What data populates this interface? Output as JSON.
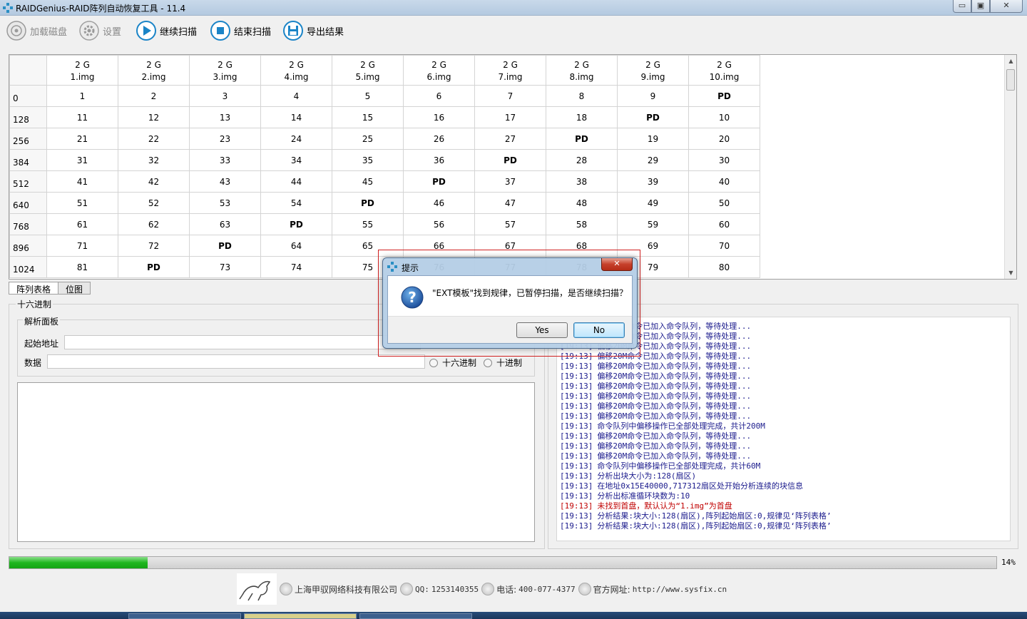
{
  "window": {
    "title": "RAIDGenius-RAID阵列自动恢复工具 - 11.4",
    "min": "▭",
    "max": "▣",
    "close": "✕"
  },
  "toolbar": {
    "load_disk": "加载磁盘",
    "settings": "设置",
    "continue_scan": "继续扫描",
    "stop_scan": "结束扫描",
    "export": "导出结果"
  },
  "grid": {
    "columns": [
      {
        "size": "2 G",
        "file": "1.img"
      },
      {
        "size": "2 G",
        "file": "2.img"
      },
      {
        "size": "2 G",
        "file": "3.img"
      },
      {
        "size": "2 G",
        "file": "4.img"
      },
      {
        "size": "2 G",
        "file": "5.img"
      },
      {
        "size": "2 G",
        "file": "6.img"
      },
      {
        "size": "2 G",
        "file": "7.img"
      },
      {
        "size": "2 G",
        "file": "8.img"
      },
      {
        "size": "2 G",
        "file": "9.img"
      },
      {
        "size": "2 G",
        "file": "10.img"
      }
    ],
    "rows": [
      {
        "offset": "0",
        "cells": [
          "1",
          "2",
          "3",
          "4",
          "5",
          "6",
          "7",
          "8",
          "9",
          "PD"
        ]
      },
      {
        "offset": "128",
        "cells": [
          "11",
          "12",
          "13",
          "14",
          "15",
          "16",
          "17",
          "18",
          "PD",
          "10"
        ]
      },
      {
        "offset": "256",
        "cells": [
          "21",
          "22",
          "23",
          "24",
          "25",
          "26",
          "27",
          "PD",
          "19",
          "20"
        ]
      },
      {
        "offset": "384",
        "cells": [
          "31",
          "32",
          "33",
          "34",
          "35",
          "36",
          "PD",
          "28",
          "29",
          "30"
        ]
      },
      {
        "offset": "512",
        "cells": [
          "41",
          "42",
          "43",
          "44",
          "45",
          "PD",
          "37",
          "38",
          "39",
          "40"
        ]
      },
      {
        "offset": "640",
        "cells": [
          "51",
          "52",
          "53",
          "54",
          "PD",
          "46",
          "47",
          "48",
          "49",
          "50"
        ]
      },
      {
        "offset": "768",
        "cells": [
          "61",
          "62",
          "63",
          "PD",
          "55",
          "56",
          "57",
          "58",
          "59",
          "60"
        ]
      },
      {
        "offset": "896",
        "cells": [
          "71",
          "72",
          "PD",
          "64",
          "65",
          "66",
          "67",
          "68",
          "69",
          "70"
        ]
      },
      {
        "offset": "1024",
        "cells": [
          "81",
          "PD",
          "73",
          "74",
          "75",
          "76",
          "77",
          "78",
          "79",
          "80"
        ]
      }
    ]
  },
  "tabs": {
    "array_table": "阵列表格",
    "bitmap": "位图"
  },
  "hex_panel": {
    "title": "十六进制",
    "parse_title": "解析面板",
    "start_addr_label": "起始地址",
    "data_label": "数据",
    "radio_hex": "十六进制",
    "radio_dec": "十进制"
  },
  "log": [
    {
      "t": "[19:13]",
      "m": "偏移20M命令已加入命令队列，等待处理..."
    },
    {
      "t": "[19:13]",
      "m": "偏移20M命令已加入命令队列，等待处理..."
    },
    {
      "t": "[19:13]",
      "m": "偏移20M命令已加入命令队列，等待处理..."
    },
    {
      "t": "[19:13]",
      "m": "偏移20M命令已加入命令队列，等待处理..."
    },
    {
      "t": "[19:13]",
      "m": "偏移20M命令已加入命令队列，等待处理..."
    },
    {
      "t": "[19:13]",
      "m": "偏移20M命令已加入命令队列，等待处理..."
    },
    {
      "t": "[19:13]",
      "m": "偏移20M命令已加入命令队列，等待处理..."
    },
    {
      "t": "[19:13]",
      "m": "偏移20M命令已加入命令队列，等待处理..."
    },
    {
      "t": "[19:13]",
      "m": "偏移20M命令已加入命令队列，等待处理..."
    },
    {
      "t": "[19:13]",
      "m": "偏移20M命令已加入命令队列，等待处理..."
    },
    {
      "t": "[19:13]",
      "m": "命令队列中偏移操作已全部处理完成，共计200M"
    },
    {
      "t": "[19:13]",
      "m": "偏移20M命令已加入命令队列，等待处理..."
    },
    {
      "t": "[19:13]",
      "m": "偏移20M命令已加入命令队列，等待处理..."
    },
    {
      "t": "[19:13]",
      "m": "偏移20M命令已加入命令队列，等待处理..."
    },
    {
      "t": "[19:13]",
      "m": "命令队列中偏移操作已全部处理完成，共计60M"
    },
    {
      "t": "[19:13]",
      "m": "分析出块大小为:128(扇区)"
    },
    {
      "t": "[19:13]",
      "m": "在地址0x15E40000,717312扇区处开始分析连续的块信息"
    },
    {
      "t": "[19:13]",
      "m": "分析出标准循环块数为:10"
    },
    {
      "t": "[19:13]",
      "m": "未找到首盘，默认认为“1.img”为首盘",
      "error": true
    },
    {
      "t": "[19:13]",
      "m": "分析结果:块大小:128(扇区),阵列起始扇区:0,规律见‘阵列表格’"
    },
    {
      "t": "[19:13]",
      "m": "分析结果:块大小:128(扇区),阵列起始扇区:0,规律见‘阵列表格’"
    }
  ],
  "progress": {
    "value": 0.14,
    "label": "14%"
  },
  "footer": {
    "company": "上海甲驭网络科技有限公司",
    "qq_label": "QQ:",
    "qq": "1253140355",
    "phone_label": "电话:",
    "phone": "400-077-4377",
    "site_label": "官方网址:",
    "site": "http://www.sysfix.cn"
  },
  "dialog": {
    "title": "提示",
    "message": "\"EXT模板\"找到规律，已暂停扫描，是否继续扫描？",
    "yes": "Yes",
    "no": "No",
    "close": "✕"
  },
  "colors": {
    "progress": "#1fb61f",
    "log_text": "#1a1a8c",
    "log_error": "#c00000",
    "accent": "#1a84c7"
  }
}
